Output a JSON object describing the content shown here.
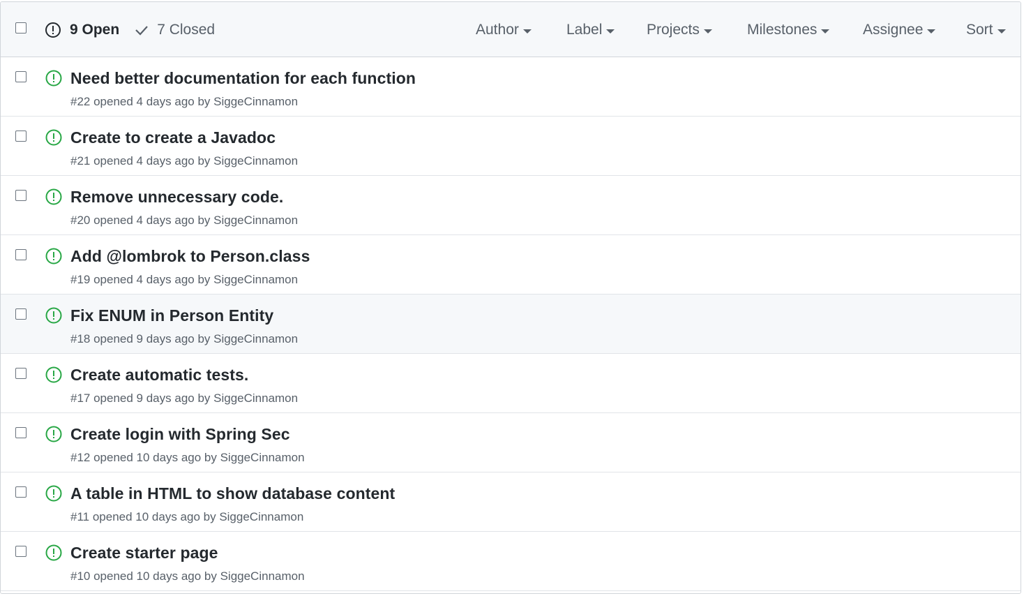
{
  "header": {
    "open_label": "9 Open",
    "closed_label": "7 Closed",
    "filters": [
      {
        "label": "Author"
      },
      {
        "label": "Label"
      },
      {
        "label": "Projects"
      },
      {
        "label": "Milestones"
      },
      {
        "label": "Assignee"
      },
      {
        "label": "Sort"
      }
    ]
  },
  "issues": [
    {
      "title": "Need better documentation for each function",
      "number": "#22",
      "opened": " opened 4 days ago by ",
      "author": "SiggeCinnamon"
    },
    {
      "title": "Create to create a Javadoc",
      "number": "#21",
      "opened": " opened 4 days ago by ",
      "author": "SiggeCinnamon"
    },
    {
      "title": "Remove unnecessary code.",
      "number": "#20",
      "opened": " opened 4 days ago by ",
      "author": "SiggeCinnamon"
    },
    {
      "title": "Add @lombrok to Person.class",
      "number": "#19",
      "opened": " opened 4 days ago by ",
      "author": "SiggeCinnamon"
    },
    {
      "title": "Fix ENUM in Person Entity",
      "number": "#18",
      "opened": " opened 9 days ago by ",
      "author": "SiggeCinnamon"
    },
    {
      "title": "Create automatic tests.",
      "number": "#17",
      "opened": " opened 9 days ago by ",
      "author": "SiggeCinnamon"
    },
    {
      "title": "Create login with Spring Sec",
      "number": "#12",
      "opened": " opened 10 days ago by ",
      "author": "SiggeCinnamon"
    },
    {
      "title": "A table in HTML to show database content",
      "number": "#11",
      "opened": " opened 10 days ago by ",
      "author": "SiggeCinnamon"
    },
    {
      "title": "Create starter page",
      "number": "#10",
      "opened": " opened 10 days ago by ",
      "author": "SiggeCinnamon"
    }
  ],
  "colors": {
    "open_icon": "#28a745",
    "text": "#24292e",
    "muted": "#586069",
    "header_bg": "#f6f8fa",
    "border": "#d1d5da"
  }
}
